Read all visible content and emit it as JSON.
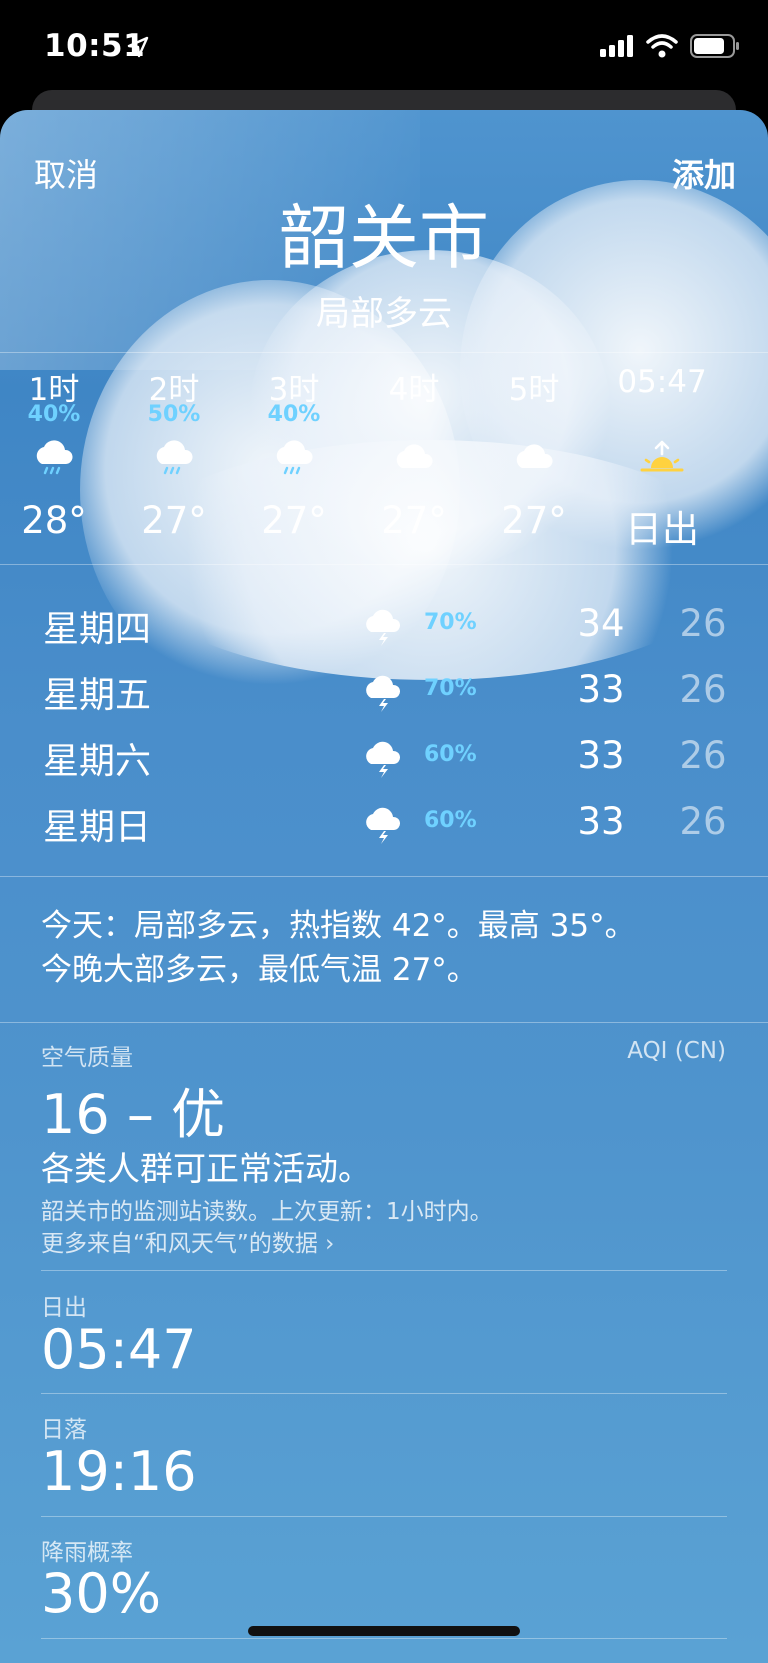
{
  "status": {
    "time": "10:51"
  },
  "header": {
    "cancel": "取消",
    "add": "添加",
    "city": "韶关市",
    "condition": "局部多云"
  },
  "hourly": [
    {
      "label": "1时",
      "pct": "40%",
      "icon": "rain-cloud-icon",
      "temp": "28°"
    },
    {
      "label": "2时",
      "pct": "50%",
      "icon": "rain-cloud-icon",
      "temp": "27°"
    },
    {
      "label": "3时",
      "pct": "40%",
      "icon": "rain-cloud-icon",
      "temp": "27°"
    },
    {
      "label": "4时",
      "pct": "",
      "icon": "cloud-icon",
      "temp": "27°"
    },
    {
      "label": "5时",
      "pct": "",
      "icon": "cloud-icon",
      "temp": "27°"
    },
    {
      "label": "05:47",
      "pct": "",
      "icon": "sunrise-icon",
      "temp": "日出"
    }
  ],
  "daily": [
    {
      "day": "星期四",
      "pct": "70%",
      "hi": "34",
      "lo": "26"
    },
    {
      "day": "星期五",
      "pct": "70%",
      "hi": "33",
      "lo": "26"
    },
    {
      "day": "星期六",
      "pct": "60%",
      "hi": "33",
      "lo": "26"
    },
    {
      "day": "星期日",
      "pct": "60%",
      "hi": "33",
      "lo": "26"
    }
  ],
  "summary": {
    "line1": "今天：局部多云，热指数 42°。最高 35°。",
    "line2": "今晚大部多云，最低气温 27°。"
  },
  "air": {
    "label": "空气质量",
    "tag": "AQI (CN)",
    "value": "16 – 优",
    "desc": "各类人群可正常活动。",
    "note1": "韶关市的监测站读数。上次更新：1小时内。",
    "note2": "更多来自“和风天气”的数据 ›"
  },
  "details": [
    {
      "label": "日出",
      "value": "05:47"
    },
    {
      "label": "日落",
      "value": "19:16"
    },
    {
      "label": "降雨概率",
      "value": "30%"
    }
  ],
  "colors": {
    "precip": "#6fd1ff",
    "sun": "#ffd23f"
  }
}
